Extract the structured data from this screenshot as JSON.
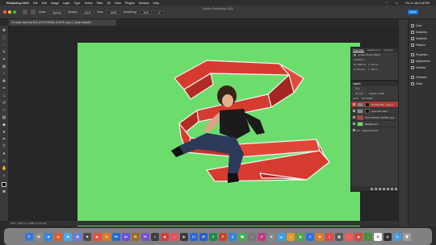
{
  "menubar": {
    "app": "Photoshop 2024",
    "items": [
      "File",
      "Edit",
      "Image",
      "Layer",
      "Type",
      "Select",
      "Filter",
      "3D",
      "View",
      "Plugins",
      "Window",
      "Help"
    ],
    "clock": "Thu 11 Jan 5:48 PM"
  },
  "window": {
    "title": "Adobe Photoshop 2024"
  },
  "options": {
    "mode_label": "Mode:",
    "mode_value": "Normal",
    "opacity_label": "Opacity:",
    "opacity_value": "100%",
    "flow_label": "Flow:",
    "flow_value": "100%",
    "smoothing_label": "Smoothing:",
    "smoothing_value": "10%",
    "angle_value": "0°",
    "share_label": "Share"
  },
  "doc": {
    "tab_title": "03 zealot faced @ 50% (POLYGONAL SHAPE copy 2, Quick Mask/8) *",
    "status": "50% · 1920 px x 1080 px (72 ppi)"
  },
  "tools": [
    "move",
    "marquee",
    "lasso",
    "quick-select",
    "crop",
    "frame",
    "eyedropper",
    "heal",
    "brush",
    "stamp",
    "history",
    "eraser",
    "gradient",
    "blur",
    "dodge",
    "pen",
    "type",
    "path-select",
    "rectangle",
    "hand",
    "zoom"
  ],
  "right_panels": {
    "group1": [
      "Color",
      "Swatches",
      "Gradients",
      "Patterns"
    ],
    "group2": [
      "Properties",
      "Adjustments",
      "Libraries"
    ],
    "group3": [
      "Channels",
      "Paths"
    ]
  },
  "properties_panel": {
    "tabs": [
      "Properties",
      "Adjustments",
      "Libraries"
    ],
    "kind": "Linked Smart Object",
    "transform_label": "Transform",
    "w": "W: 2960 px",
    "h": "H: 1674 px",
    "x": "X: 147 px",
    "y": "Y: -83 px"
  },
  "layers_panel": {
    "title": "Layers",
    "filter_label": "Kind",
    "blend_mode": "Normal",
    "opacity": "Opacity: 100%",
    "lock_label": "Lock:",
    "fill": "Fill: 100%",
    "layers": [
      {
        "name": "CUTOUT(E...copy 2",
        "selected": true
      },
      {
        "name": "guys and robot",
        "selected": false
      },
      {
        "name": "POLYGONAL SHAPE copy",
        "selected": false
      },
      {
        "name": "Background",
        "selected": false
      },
      {
        "name": "spaces and the",
        "selected": false
      }
    ]
  },
  "dock": {
    "apps": [
      {
        "label": "F",
        "color": "#3a78d8"
      },
      {
        "label": "⌘",
        "color": "#8a8a8a"
      },
      {
        "label": "⊕",
        "color": "#2d88e8"
      },
      {
        "label": "◎",
        "color": "#de5c2b"
      },
      {
        "label": "✉",
        "color": "#4aa8ee"
      },
      {
        "label": "⊞",
        "color": "#6b7cd6"
      },
      {
        "label": "❖",
        "color": "#4c4c4c"
      },
      {
        "label": "◉",
        "color": "#f04a3a"
      },
      {
        "label": "Ai",
        "color": "#e37a1a"
      },
      {
        "label": "Ps",
        "color": "#1b6fd0"
      },
      {
        "label": "Ae",
        "color": "#6a4fd8"
      },
      {
        "label": "Br",
        "color": "#9a6d1f"
      },
      {
        "label": "Pr",
        "color": "#7a4fcf"
      },
      {
        "label": "≡",
        "color": "#3f3f3f"
      },
      {
        "label": "◆",
        "color": "#d04040"
      },
      {
        "label": "♫",
        "color": "#e8505f"
      },
      {
        "label": "▶",
        "color": "#3c3c3c"
      },
      {
        "label": "Lr",
        "color": "#2c6ad9"
      },
      {
        "label": "W",
        "color": "#2b5fc6"
      },
      {
        "label": "X",
        "color": "#1f8a48"
      },
      {
        "label": "P",
        "color": "#c9452a"
      },
      {
        "label": "A",
        "color": "#2f86e0"
      },
      {
        "label": "☎",
        "color": "#3fb34f"
      },
      {
        "label": "◐",
        "color": "#777777"
      },
      {
        "label": "✦",
        "color": "#c23a84"
      },
      {
        "label": "⚙",
        "color": "#888888"
      },
      {
        "label": "☁",
        "color": "#3da1e6"
      },
      {
        "label": "♦",
        "color": "#e39a2c"
      },
      {
        "label": "◍",
        "color": "#50a84a"
      },
      {
        "label": "Z",
        "color": "#2d71e2"
      },
      {
        "label": "✿",
        "color": "#e07b22"
      },
      {
        "label": "●",
        "color": "#e34646"
      },
      {
        "label": "▣",
        "color": "#5a5a5a"
      },
      {
        "label": "♪",
        "color": "#f25a5a"
      },
      {
        "label": "◈",
        "color": "#d24b3c"
      },
      {
        "label": "⌂",
        "color": "#4a8e3c"
      },
      {
        "label": "U",
        "color": "#f2f2f2"
      },
      {
        "label": "⎙",
        "color": "#2f2f2f"
      },
      {
        "label": "✎",
        "color": "#4b9cdc"
      },
      {
        "label": "🗑",
        "color": "#9a9a9a"
      }
    ]
  },
  "colors": {
    "canvas_green": "#6cdd6c",
    "shape_red": "#d63b2f",
    "accent": "#1473e6"
  }
}
